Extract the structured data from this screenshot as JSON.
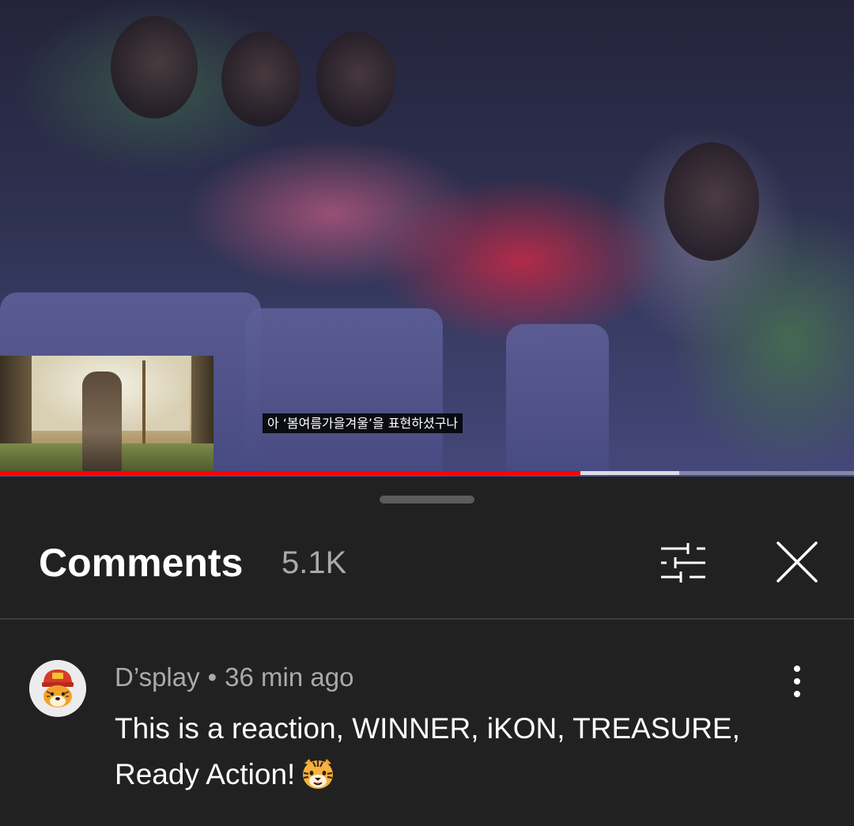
{
  "video": {
    "subtitle": "아 ‘봄여름가을겨울’을 표현하셨구나",
    "progress_played": 0.68,
    "progress_buffered": 0.795
  },
  "comments_panel": {
    "title": "Comments",
    "count": "5.1K",
    "filter_icon": "sliders-icon",
    "close_icon": "close-icon"
  },
  "comment": {
    "author": "D’splay",
    "separator": "•",
    "time": "36 min ago",
    "text": "This is a reaction, WINNER, iKON, TREASURE, Ready Action!",
    "emoji": "tiger-face-emoji",
    "more_icon": "more-vertical-icon"
  },
  "colors": {
    "background": "#212121",
    "progress_red": "#ff0000",
    "secondary_text": "#aaaaaa"
  }
}
